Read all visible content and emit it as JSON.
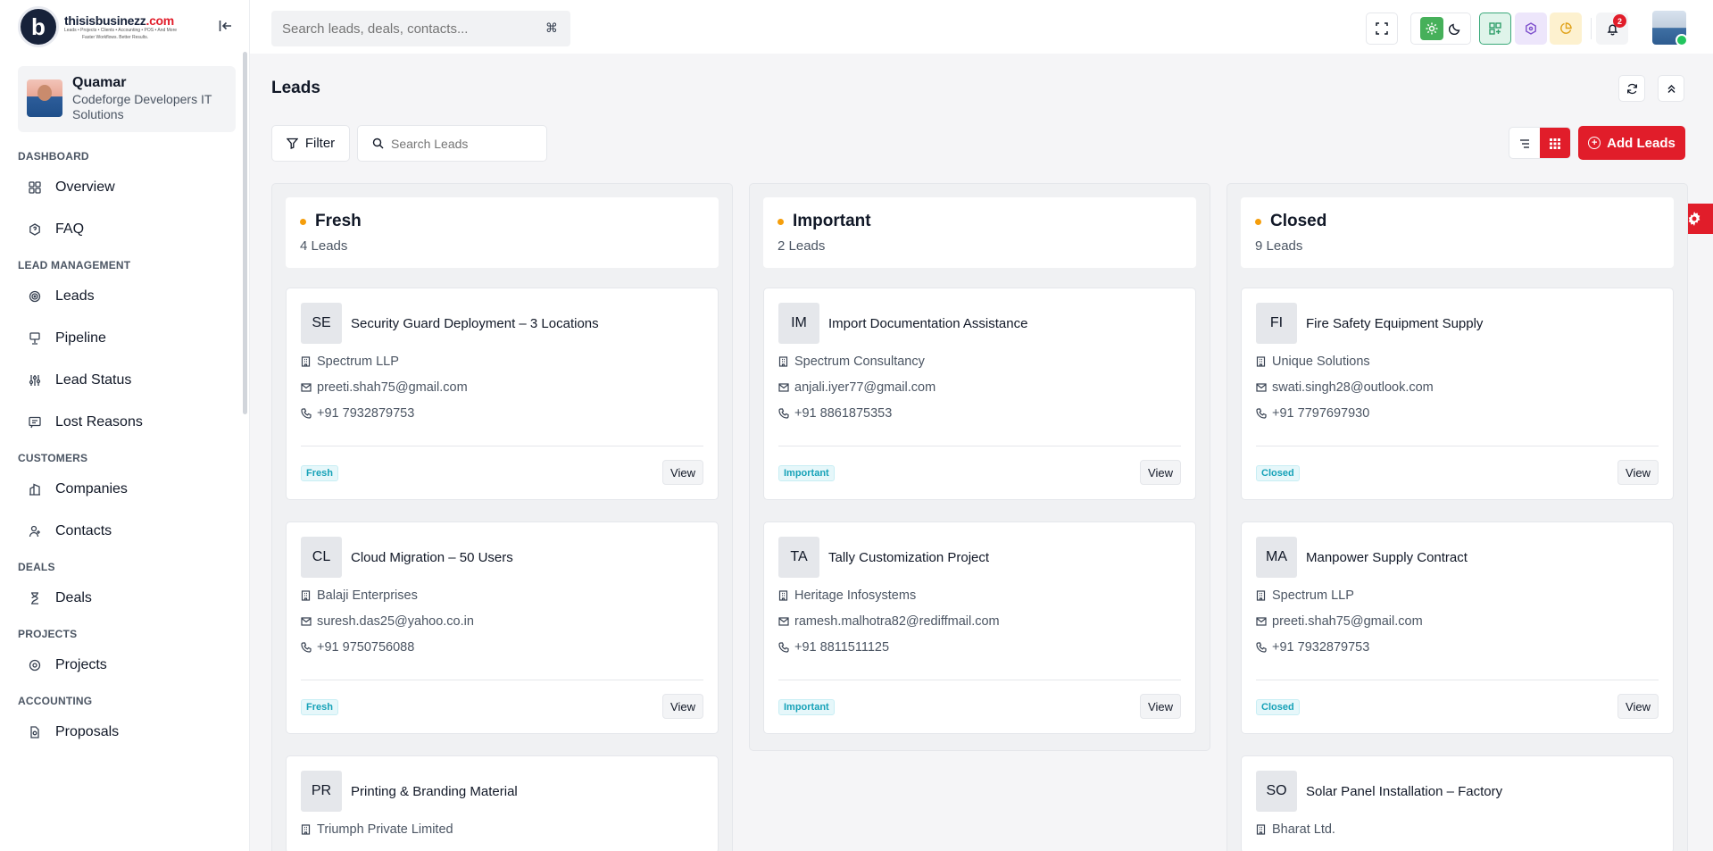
{
  "brand": {
    "logo_letter": "b",
    "name_main": "thisisbusinezz",
    "name_tld": ".com",
    "tagline": "Leads • Projects • Clients • Accounting • POS • And More",
    "slogan": "Faster Workflows. Better Results."
  },
  "topbar": {
    "search_placeholder": "Search leads, deals, contacts...",
    "search_shortcut": "⌘",
    "notification_count": "2"
  },
  "profile": {
    "name": "Quamar",
    "company": "Codeforge Developers IT Solutions"
  },
  "sidebar": {
    "sections": [
      {
        "title": "DASHBOARD",
        "items": [
          {
            "label": "Overview",
            "icon": "grid-icon"
          },
          {
            "label": "FAQ",
            "icon": "faq-icon"
          }
        ]
      },
      {
        "title": "LEAD MANAGEMENT",
        "items": [
          {
            "label": "Leads",
            "icon": "target-icon"
          },
          {
            "label": "Pipeline",
            "icon": "pipeline-icon"
          },
          {
            "label": "Lead Status",
            "icon": "sliders-icon"
          },
          {
            "label": "Lost Reasons",
            "icon": "message-icon"
          }
        ]
      },
      {
        "title": "CUSTOMERS",
        "items": [
          {
            "label": "Companies",
            "icon": "building-icon"
          },
          {
            "label": "Contacts",
            "icon": "user-icon"
          }
        ]
      },
      {
        "title": "DEALS",
        "items": [
          {
            "label": "Deals",
            "icon": "hourglass-icon"
          }
        ]
      },
      {
        "title": "PROJECTS",
        "items": [
          {
            "label": "Projects",
            "icon": "project-icon"
          }
        ]
      },
      {
        "title": "ACCOUNTING",
        "items": [
          {
            "label": "Proposals",
            "icon": "document-icon"
          }
        ]
      }
    ]
  },
  "main": {
    "page_title": "Leads",
    "filter_label": "Filter",
    "search_placeholder": "Search Leads",
    "add_label": "Add Leads",
    "accent_color": "#e11d2a"
  },
  "columns": [
    {
      "title": "Fresh",
      "count": "4 Leads",
      "cards": [
        {
          "initials": "SE",
          "title": "Security Guard Deployment – 3 Locations",
          "company": "Spectrum LLP",
          "email": "preeti.shah75@gmail.com",
          "phone": "+91 7932879753",
          "tag": "Fresh",
          "view": "View"
        },
        {
          "initials": "CL",
          "title": "Cloud Migration – 50 Users",
          "company": "Balaji Enterprises",
          "email": "suresh.das25@yahoo.co.in",
          "phone": "+91 9750756088",
          "tag": "Fresh",
          "view": "View"
        },
        {
          "initials": "PR",
          "title": "Printing & Branding Material",
          "company": "Triumph Private Limited"
        }
      ]
    },
    {
      "title": "Important",
      "count": "2 Leads",
      "cards": [
        {
          "initials": "IM",
          "title": "Import Documentation Assistance",
          "company": "Spectrum Consultancy",
          "email": "anjali.iyer77@gmail.com",
          "phone": "+91 8861875353",
          "tag": "Important",
          "view": "View"
        },
        {
          "initials": "TA",
          "title": "Tally Customization Project",
          "company": "Heritage Infosystems",
          "email": "ramesh.malhotra82@rediffmail.com",
          "phone": "+91 8811511125",
          "tag": "Important",
          "view": "View"
        }
      ]
    },
    {
      "title": "Closed",
      "count": "9 Leads",
      "cards": [
        {
          "initials": "FI",
          "title": "Fire Safety Equipment Supply",
          "company": "Unique Solutions",
          "email": "swati.singh28@outlook.com",
          "phone": "+91 7797697930",
          "tag": "Closed",
          "view": "View"
        },
        {
          "initials": "MA",
          "title": "Manpower Supply Contract",
          "company": "Spectrum LLP",
          "email": "preeti.shah75@gmail.com",
          "phone": "+91 7932879753",
          "tag": "Closed",
          "view": "View"
        },
        {
          "initials": "SO",
          "title": "Solar Panel Installation – Factory",
          "company": "Bharat Ltd."
        }
      ]
    }
  ]
}
